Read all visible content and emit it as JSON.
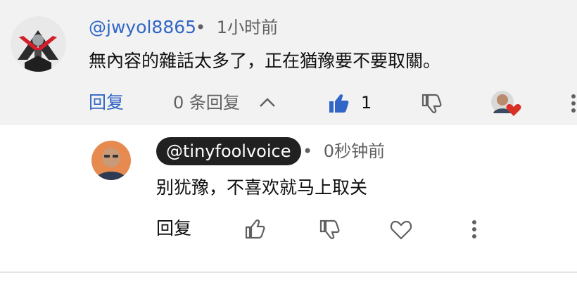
{
  "comment": {
    "handle": "@jwyol8865",
    "separator": "•",
    "time": "1小时前",
    "text": "無內容的雜話太多了，正在猶豫要不要取關。",
    "actions": {
      "reply_label": "回复",
      "reply_count_label": "0 条回复",
      "like_count": "1"
    }
  },
  "reply": {
    "handle": "@tinyfoolvoice",
    "separator": "•",
    "time": "0秒钟前",
    "text": "别犹豫，不喜欢就马上取关",
    "actions": {
      "reply_label": "回复"
    }
  },
  "colors": {
    "link_blue": "#3166c6",
    "like_blue": "#3166c6",
    "heart_red": "#d93025",
    "muted": "#606060",
    "top_background": "#f2f2f2"
  }
}
